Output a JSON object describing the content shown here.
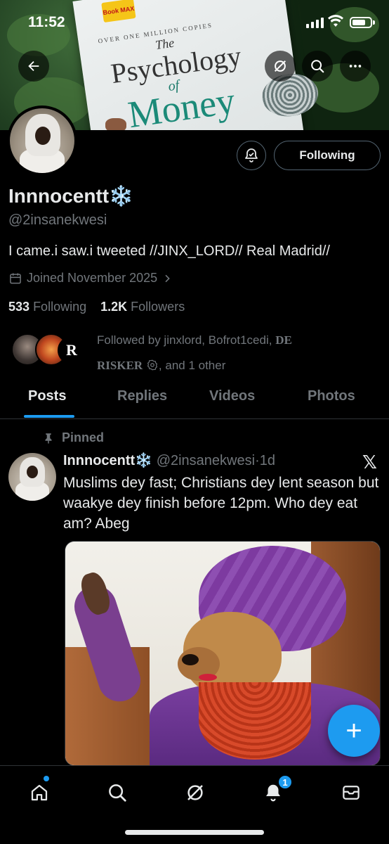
{
  "status_bar": {
    "time": "11:52"
  },
  "banner": {
    "book_sticker": "Book MAX",
    "book_copies": "OVER ONE MILLION COPIES",
    "book_the": "The",
    "book_psychology": "Psychology",
    "book_of": "of",
    "book_money": "Money"
  },
  "header_buttons": {
    "back_icon": "arrow-left-icon",
    "grok_icon": "grok-icon",
    "search_icon": "search-icon",
    "more_icon": "more-icon"
  },
  "profile": {
    "follow_button": "Following",
    "name": "Innnocentt",
    "name_emoji": "❄️",
    "handle": "@2insanekwesi",
    "bio": "I came.i saw.i tweeted //JINX_LORD// Real Madrid//",
    "joined": "Joined November 2025",
    "following_count": "533",
    "following_label": "Following",
    "followers_count": "1.2K",
    "followers_label": "Followers",
    "followed_by_prefix": "Followed by jinxlord, Bofrot1cedi, ",
    "followed_by_de": "DE",
    "followed_by_risker": "RISKER",
    "followed_by_suffix": ", and 1 other",
    "followed_avatar_letter": "R"
  },
  "tabs": [
    {
      "label": "Posts",
      "active": true
    },
    {
      "label": "Replies",
      "active": false
    },
    {
      "label": "Videos",
      "active": false
    },
    {
      "label": "Photos",
      "active": false
    }
  ],
  "post": {
    "pinned_label": "Pinned",
    "author_name": "Innnocentt",
    "author_emoji": "❄️",
    "author_handle": "@2insanekwesi",
    "separator": "·",
    "time": "1d",
    "x_logo": "𝕏",
    "text": "Muslims dey fast; Christians dey lent season but waakye dey finish before 12pm. Who dey eat am? Abeg"
  },
  "fab": {
    "label": "+"
  },
  "bottom_nav": {
    "items": [
      "home-icon",
      "search-icon",
      "grok-icon",
      "notifications-icon",
      "messages-icon"
    ],
    "notifications_badge": "1"
  },
  "colors": {
    "accent": "#1d9bf0",
    "background": "#000000",
    "text": "#e7e9ea",
    "muted": "#71767b"
  }
}
